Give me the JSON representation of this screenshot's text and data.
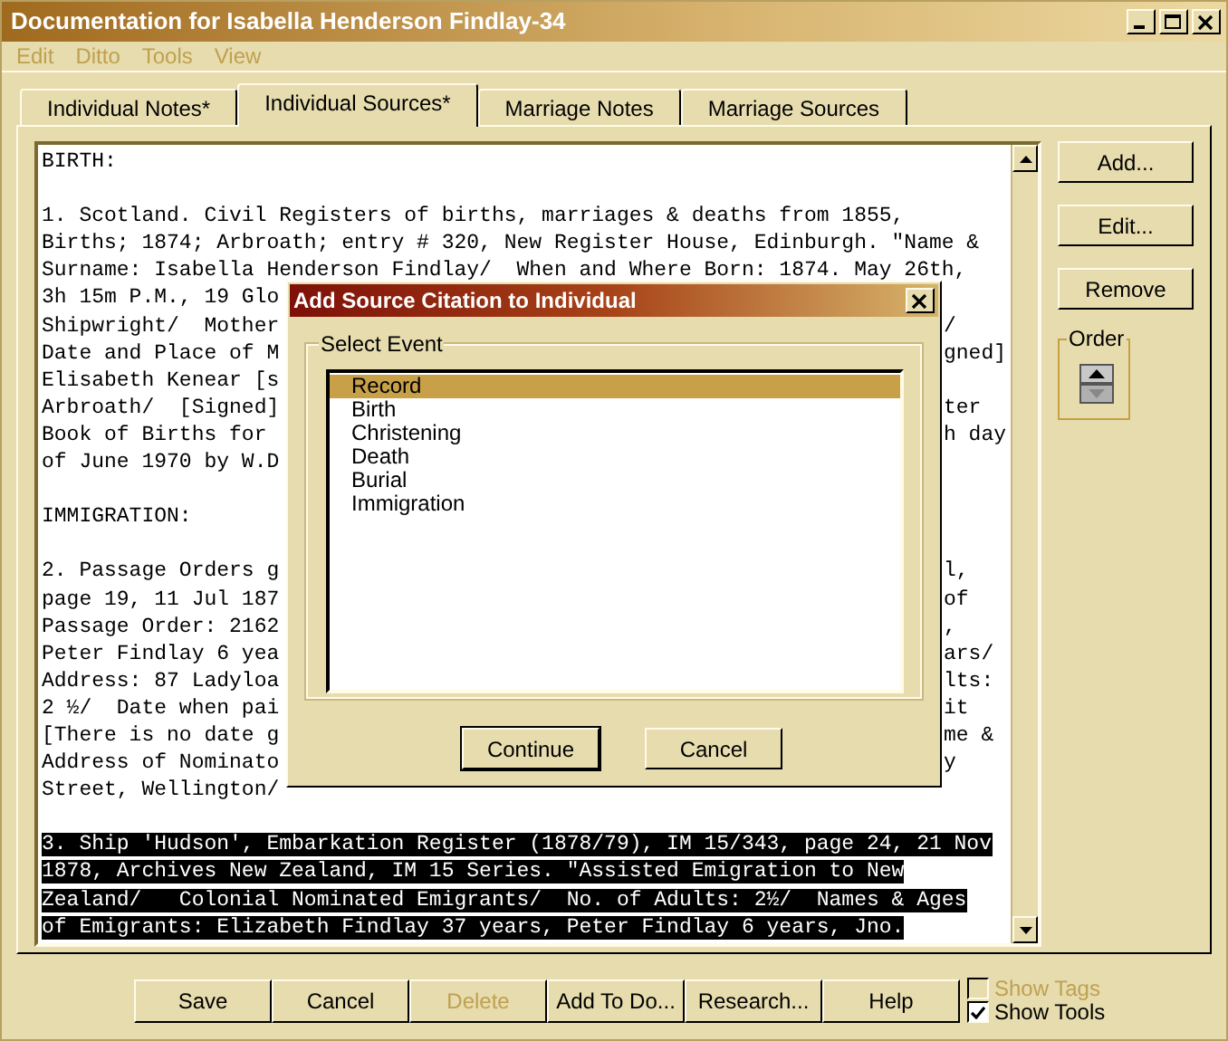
{
  "window": {
    "title": "Documentation for Isabella Henderson Findlay-34"
  },
  "menu": [
    {
      "label": "Edit"
    },
    {
      "label": "Ditto"
    },
    {
      "label": "Tools"
    },
    {
      "label": "View"
    }
  ],
  "tabs": [
    {
      "label": "Individual Notes*",
      "selected": false
    },
    {
      "label": "Individual Sources*",
      "selected": true
    },
    {
      "label": "Marriage Notes",
      "selected": false
    },
    {
      "label": "Marriage Sources",
      "selected": false
    }
  ],
  "text_lines": [
    {
      "kind": "text",
      "text": "BIRTH:",
      "highlighted": false
    },
    {
      "kind": "blank"
    },
    {
      "kind": "text",
      "text": "1. Scotland. Civil Registers of births, marriages & deaths from 1855,",
      "highlighted": false
    },
    {
      "kind": "text",
      "text": "Births; 1874; Arbroath; entry # 320, New Register House, Edinburgh. \"Name &",
      "highlighted": false
    },
    {
      "kind": "text",
      "text": "Surname: Isabella Henderson Findlay/  When and Where Born: 1874. May 26th,",
      "highlighted": false
    },
    {
      "kind": "split",
      "left": "3h 15m P.M., 19 Glo"
    },
    {
      "kind": "split",
      "left": "Shipwright/  Mother",
      "right": "/"
    },
    {
      "kind": "split",
      "left": "Date and Place of M",
      "right": "gned]"
    },
    {
      "kind": "split",
      "left": "Elisabeth Kenear [s"
    },
    {
      "kind": "split",
      "left": "Arbroath/  [Signed]",
      "right": "ter"
    },
    {
      "kind": "split",
      "left": "Book of Births for",
      "right": "h day"
    },
    {
      "kind": "split",
      "left": "of June 1970 by W.D"
    },
    {
      "kind": "blank"
    },
    {
      "kind": "text",
      "text": "IMMIGRATION:",
      "highlighted": false
    },
    {
      "kind": "blank"
    },
    {
      "kind": "split",
      "left": "2. Passage Orders g",
      "right": "l,"
    },
    {
      "kind": "split",
      "left": "page 19, 11 Jul 187",
      "right": "of"
    },
    {
      "kind": "split",
      "left": "Passage Order: 2162",
      "right": ","
    },
    {
      "kind": "split",
      "left": "Peter Findlay 6 yea",
      "right": "ars/"
    },
    {
      "kind": "split",
      "left": "Address: 87 Ladyloa",
      "right": "lts:"
    },
    {
      "kind": "split",
      "left": "2 ½/  Date when pai",
      "right": "it"
    },
    {
      "kind": "split",
      "left": "[There is no date g",
      "right": "me &"
    },
    {
      "kind": "split",
      "left": "Address of Nominato",
      "right": "y"
    },
    {
      "kind": "split",
      "left": "Street, Wellington/"
    },
    {
      "kind": "blank"
    },
    {
      "kind": "text",
      "text": "3. Ship 'Hudson', Embarkation Register (1878/79), IM 15/343, page 24, 21 Nov",
      "highlighted": true
    },
    {
      "kind": "text",
      "text": "1878, Archives New Zealand, IM 15 Series. \"Assisted Emigration to New",
      "highlighted": true
    },
    {
      "kind": "text",
      "text": "Zealand/   Colonial Nominated Emigrants/  No. of Adults: 2½/  Names & Ages",
      "highlighted": true
    },
    {
      "kind": "text",
      "text": "of Emigrants: Elizabeth Findlay 37 years, Peter Findlay 6 years, Jno.",
      "highlighted": true
    }
  ],
  "side_buttons": [
    {
      "label": "Add..."
    },
    {
      "label": "Edit..."
    },
    {
      "label": "Remove"
    }
  ],
  "order": {
    "label": "Order",
    "up_disabled": false,
    "down_disabled": true
  },
  "bottom_buttons": [
    {
      "label": "Save",
      "disabled": false
    },
    {
      "label": "Cancel",
      "disabled": false
    },
    {
      "label": "Delete",
      "disabled": true
    },
    {
      "label": "Add To Do...",
      "disabled": false
    },
    {
      "label": "Research...",
      "disabled": false
    },
    {
      "label": "Help",
      "disabled": false
    }
  ],
  "checkboxes": [
    {
      "label": "Show Tags",
      "checked": false,
      "disabled": true
    },
    {
      "label": "Show Tools",
      "checked": true,
      "disabled": false
    }
  ],
  "dialog": {
    "title": "Add Source Citation to Individual",
    "group_label": "Select Event",
    "events": [
      {
        "label": "Record",
        "selected": true
      },
      {
        "label": "Birth",
        "selected": false
      },
      {
        "label": "Christening",
        "selected": false
      },
      {
        "label": "Death",
        "selected": false
      },
      {
        "label": "Burial",
        "selected": false
      },
      {
        "label": "Immigration",
        "selected": false
      }
    ],
    "buttons": [
      {
        "label": "Continue",
        "default": true
      },
      {
        "label": "Cancel",
        "default": false
      }
    ]
  }
}
